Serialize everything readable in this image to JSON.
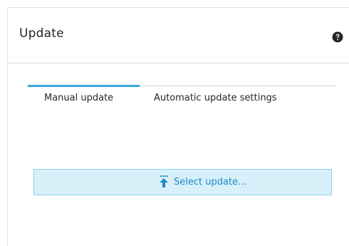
{
  "panel": {
    "title": "Update",
    "help_icon": "help-question-icon"
  },
  "tabs": [
    {
      "label": "Manual update",
      "active": true
    },
    {
      "label": "Automatic update settings",
      "active": false
    }
  ],
  "select_update": {
    "label": "Select update...",
    "icon": "upload-arrow-icon"
  },
  "colors": {
    "accent": "#36a9e1",
    "button_bg": "#d7f0fa",
    "button_border": "#8fd3ee",
    "button_text": "#1e8bc3"
  }
}
